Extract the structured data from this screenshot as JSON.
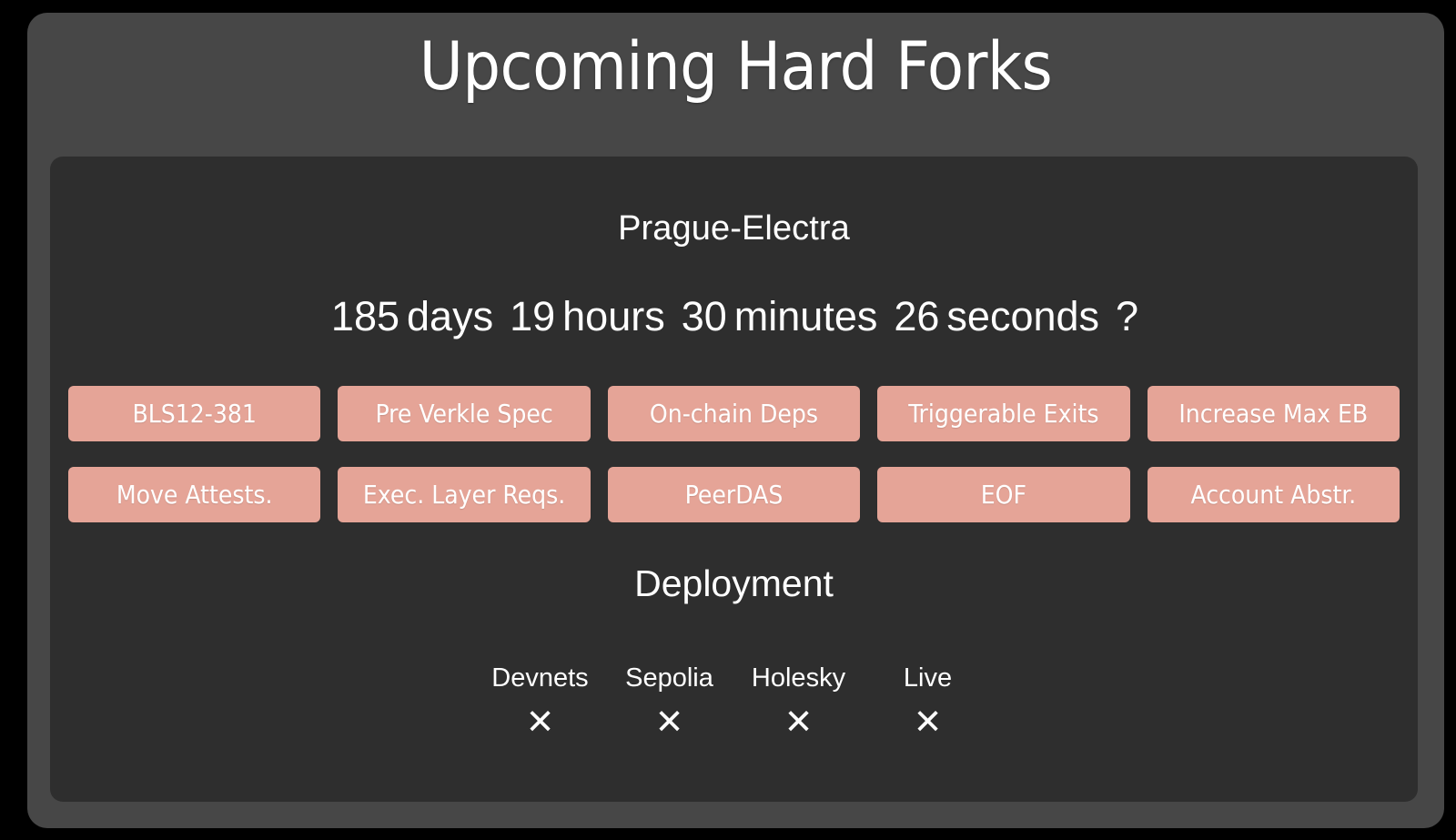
{
  "header": {
    "title": "Upcoming Hard Forks"
  },
  "fork": {
    "name": "Prague-Electra",
    "countdown": {
      "days_value": "185",
      "days_label": "days",
      "hours_value": "19",
      "hours_label": "hours",
      "minutes_value": "30",
      "minutes_label": "minutes",
      "seconds_value": "26",
      "seconds_label": "seconds",
      "suffix": "?"
    },
    "eips": [
      {
        "label": "BLS12-381"
      },
      {
        "label": "Pre Verkle Spec"
      },
      {
        "label": "On-chain Deps"
      },
      {
        "label": "Triggerable Exits"
      },
      {
        "label": "Increase Max EB"
      },
      {
        "label": "Move Attests."
      },
      {
        "label": "Exec. Layer Reqs."
      },
      {
        "label": "PeerDAS"
      },
      {
        "label": "EOF"
      },
      {
        "label": "Account Abstr."
      }
    ],
    "deployment": {
      "title": "Deployment",
      "columns": [
        {
          "label": "Devnets",
          "status": "✕"
        },
        {
          "label": "Sepolia",
          "status": "✕"
        },
        {
          "label": "Holesky",
          "status": "✕"
        },
        {
          "label": "Live",
          "status": "✕"
        }
      ]
    }
  },
  "colors": {
    "stage_background": "#000000",
    "outer_panel": "#474747",
    "card_background": "#2e2e2e",
    "pill_background": "#e5a497",
    "text_primary": "#ffffff"
  }
}
